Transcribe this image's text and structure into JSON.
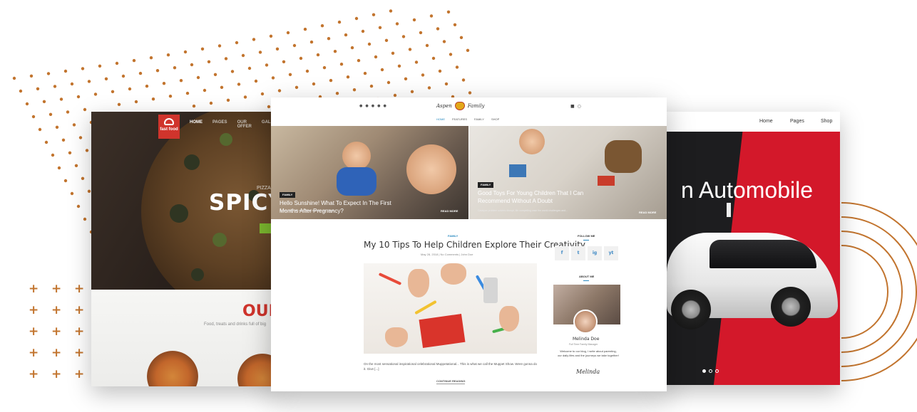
{
  "colors": {
    "accent_dots": "#c2742e",
    "fastfood_red": "#d0342c",
    "fastfood_green": "#7cb82f",
    "auto_red": "#d3182a",
    "blog_blue": "#2a8ac0"
  },
  "fastfood": {
    "logo_text": "fast food",
    "nav": [
      "HOME",
      "PAGES",
      "OUR OFFER",
      "GALLERIES"
    ],
    "hero_label": "PIZZA",
    "hero_title": "SPICY S",
    "section_title": "OUR",
    "tagline": "Food, treats and drinks full of big"
  },
  "automobile": {
    "nav": [
      "Home",
      "Pages",
      "Shop"
    ],
    "hero_title": "n Automobile"
  },
  "blog": {
    "brand_left": "Aspen",
    "brand_right": "Family",
    "social_icons": [
      "twitter-icon",
      "facebook-icon",
      "google-plus-icon",
      "pinterest-icon",
      "instagram-icon"
    ],
    "nav": [
      "HOME",
      "FEATURES",
      "FAMILY",
      "SHOP"
    ],
    "heroes": [
      {
        "category": "FAMILY",
        "title": "Hello Sunshine! What To Expect In The First Months After Pregnancy?",
        "excerpt": "So lets make the most of this beautiful day. Since...",
        "read_more": "READ MORE"
      },
      {
        "category": "FAMILY",
        "title": "Good Toys For Young Children That I Can Recommend Without A Doubt",
        "excerpt": "Catalyze problem solvers disrupt, life compelling case the world challenges and...",
        "read_more": "READ MORE"
      }
    ],
    "post": {
      "category": "FAMILY",
      "title": "My 10 Tips To Help Children Explore Their Creativity",
      "meta": "May 28, 2018 | No Comments | John Doe",
      "excerpt": "On the most sensational inspirational celebrational Muppetational... This is what we call the Muppet Show. Were gonna do it. Give [...]",
      "continue": "CONTINUE READING"
    },
    "sidebar": {
      "follow_heading": "FOLLOW ME",
      "follow_buttons": [
        "f",
        "t",
        "ig",
        "yt"
      ],
      "about_heading": "ABOUT ME",
      "author_name": "Melinda Doe",
      "author_role": "Full Time Family Manager",
      "author_bio": "Welcome to our blog, I write about parenting, our daily lifes and the journeys we take together!",
      "signature": "Melinda"
    }
  }
}
